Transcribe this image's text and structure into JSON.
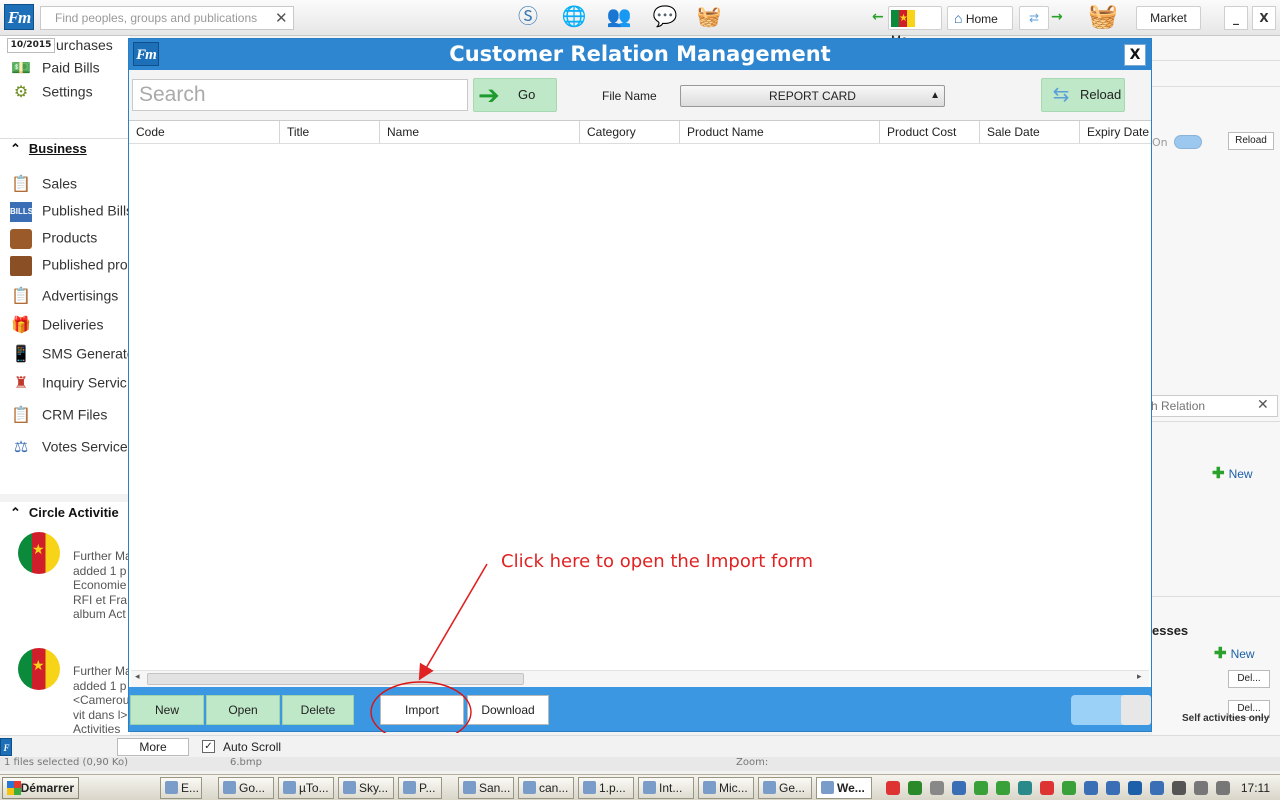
{
  "topbar": {
    "search_placeholder": "Find peoples, groups and publications",
    "me_label": "Me",
    "home_label": "Home",
    "market_label": "Market",
    "minimize_label": "_",
    "close_label": "X"
  },
  "sidebar": {
    "date_chip": "10/2015",
    "top_items": [
      {
        "label": "urchases",
        "icon": "receipt-icon"
      },
      {
        "label": "Paid Bills",
        "icon": "money-icon"
      },
      {
        "label": "Settings",
        "icon": "gear-icon"
      }
    ],
    "business_header": "Business",
    "business_items": [
      {
        "label": "Sales",
        "icon": "clipboard-icon"
      },
      {
        "label": "Published Bills",
        "icon": "bills-icon"
      },
      {
        "label": "Products",
        "icon": "box-icon"
      },
      {
        "label": "Published pro",
        "icon": "book-icon"
      },
      {
        "label": "Advertisings",
        "icon": "clipboard-icon"
      },
      {
        "label": "Deliveries",
        "icon": "delivery-icon"
      },
      {
        "label": "SMS Generato",
        "icon": "phone-icon"
      },
      {
        "label": "Inquiry Servic",
        "icon": "inquiry-icon"
      },
      {
        "label": "CRM Files",
        "icon": "clipboard-icon"
      },
      {
        "label": "Votes Service",
        "icon": "scale-icon"
      }
    ],
    "circle_header": "Circle Activitie",
    "activities": [
      {
        "text": "Further Ma\nadded 1 p\nEconomie\nRFI et Fra\nalbum Act"
      },
      {
        "text": "Further Ma\nadded 1 p\n<Camerou\nvit dans l>\nActivities"
      }
    ]
  },
  "rightpanel": {
    "reload_label": "Reload",
    "on_label": "On",
    "search_relation_placeholder": "ch Relation",
    "new_label_1": "New",
    "addresses_label": "esses",
    "new_label_2": "New",
    "del_label_1": "Del...",
    "del_label_2": "Del...",
    "self_activities": "Self activities only"
  },
  "modal": {
    "title": "Customer Relation Management",
    "close_label": "X",
    "search_placeholder": "Search",
    "go_label": "Go",
    "file_name_label": "File Name",
    "file_name_value": "REPORT CARD",
    "reload_label": "Reload",
    "columns": [
      "Code",
      "Title",
      "Name",
      "Category",
      "Product Name",
      "Product Cost",
      "Sale Date",
      "Expiry Date"
    ],
    "annotation": "Click here to open the Import form",
    "footer_buttons": {
      "new": "New",
      "open": "Open",
      "delete": "Delete",
      "import": "Import",
      "download": "Download"
    }
  },
  "bottom": {
    "more_label": "More",
    "auto_scroll_label": "Auto Scroll",
    "status_text": "1 files selected (0,90 Ko)",
    "file_text": "6.bmp",
    "zoom_label": "Zoom:"
  },
  "taskbar": {
    "start_label": "Démarrer",
    "tasks": [
      "E...",
      "Go...",
      "µTo...",
      "Sky...",
      "P...",
      "San...",
      "can...",
      "1.p...",
      "Int...",
      "Mic...",
      "Ge...",
      "We..."
    ],
    "clock": "17:11"
  }
}
